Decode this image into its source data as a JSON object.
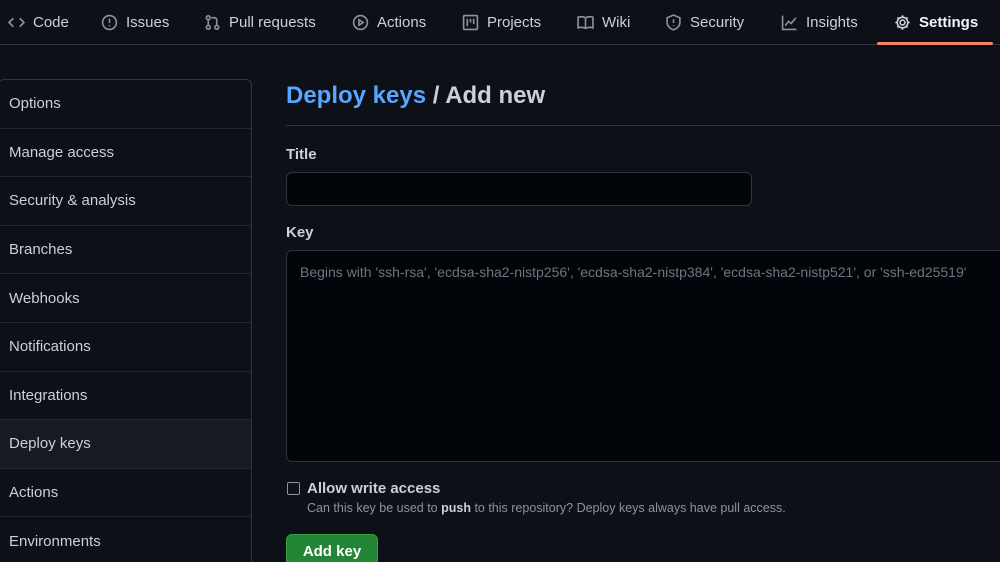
{
  "repo_nav": {
    "tabs": [
      {
        "label": "Code",
        "icon": "code-icon"
      },
      {
        "label": "Issues",
        "icon": "issue-icon"
      },
      {
        "label": "Pull requests",
        "icon": "pull-request-icon"
      },
      {
        "label": "Actions",
        "icon": "play-icon"
      },
      {
        "label": "Projects",
        "icon": "project-icon"
      },
      {
        "label": "Wiki",
        "icon": "book-icon"
      },
      {
        "label": "Security",
        "icon": "shield-icon"
      },
      {
        "label": "Insights",
        "icon": "graph-icon"
      },
      {
        "label": "Settings",
        "icon": "gear-icon",
        "active": true
      }
    ],
    "active_color": "#f78166"
  },
  "sidebar": {
    "items": [
      {
        "label": "Options"
      },
      {
        "label": "Manage access"
      },
      {
        "label": "Security & analysis"
      },
      {
        "label": "Branches"
      },
      {
        "label": "Webhooks"
      },
      {
        "label": "Notifications"
      },
      {
        "label": "Integrations"
      },
      {
        "label": "Deploy keys",
        "selected": true
      },
      {
        "label": "Actions"
      },
      {
        "label": "Environments"
      }
    ]
  },
  "main": {
    "breadcrumb_link": "Deploy keys",
    "heading_rest": " / Add new",
    "title_label": "Title",
    "title_value": "",
    "key_label": "Key",
    "key_value": "",
    "key_placeholder": "Begins with 'ssh-rsa', 'ecdsa-sha2-nistp256', 'ecdsa-sha2-nistp384', 'ecdsa-sha2-nistp521', or 'ssh-ed25519'",
    "write_access": {
      "label": "Allow write access",
      "checked": false,
      "help_before": "Can this key be used to ",
      "help_bold": "push",
      "help_after": " to this repository? Deploy keys always have pull access."
    },
    "submit_label": "Add key"
  },
  "colors": {
    "background": "#0d1117",
    "link": "#58a6ff",
    "primary_button": "#238636",
    "border": "#30363d"
  }
}
